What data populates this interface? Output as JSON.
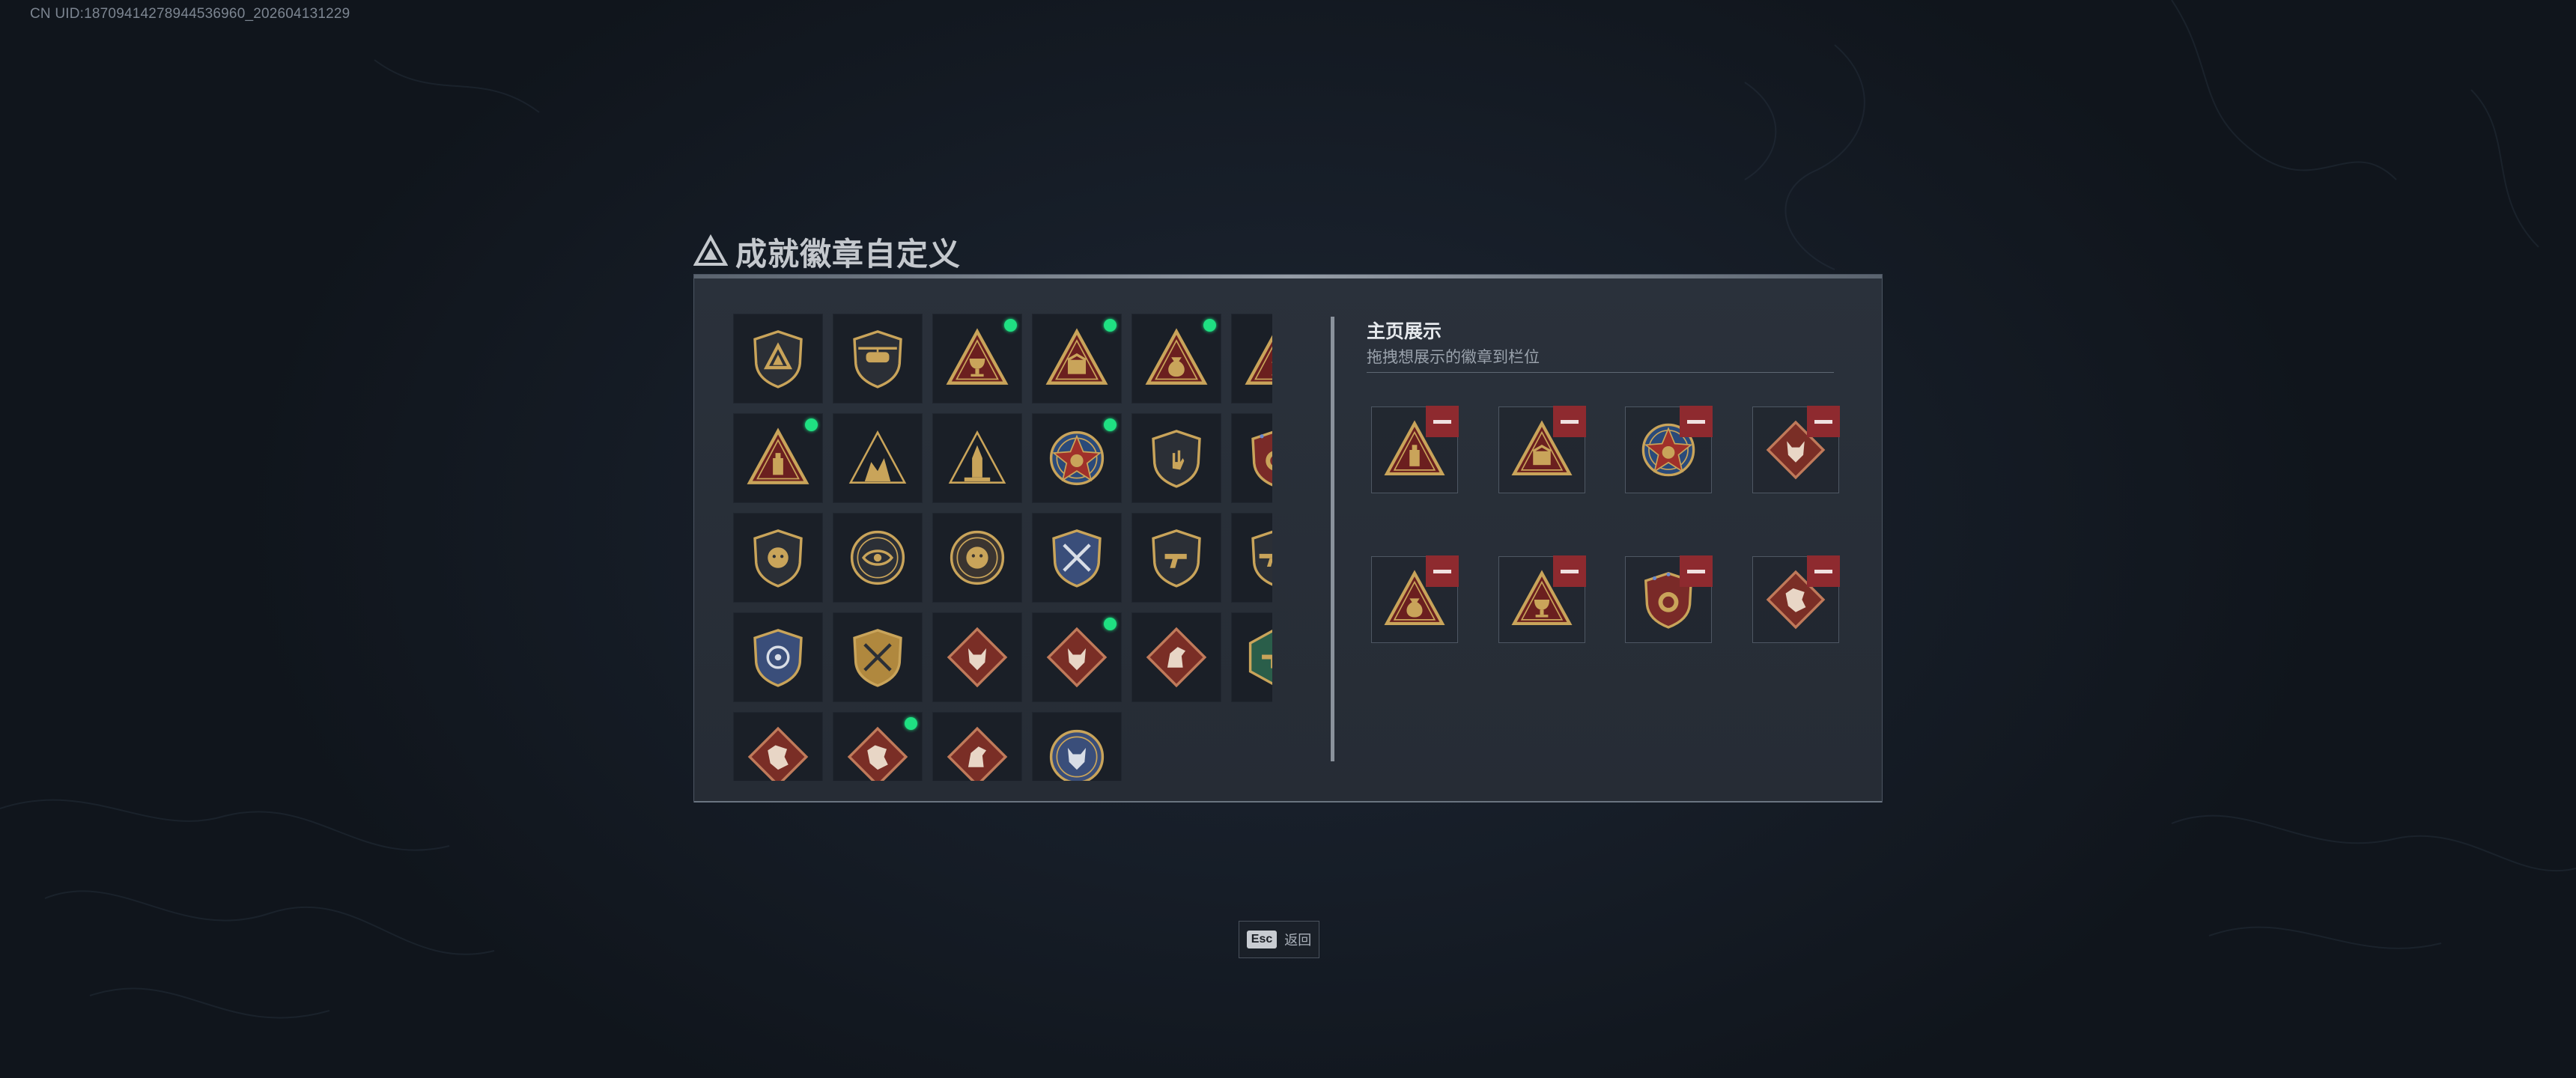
{
  "uid_text": "CN UID:18709414278944536960_202604131229",
  "title": "成就徽章自定义",
  "showcase": {
    "title": "主页展示",
    "subtitle": "拖拽想展示的徽章到栏位"
  },
  "esc": {
    "key": "Esc",
    "label": "返回"
  },
  "colors": {
    "gold": "#c9a45a",
    "dark_red": "#6b1f1f",
    "remove_red": "#8e2a2f",
    "new_dot": "#1fe082",
    "blue_shield": "#3a4e7a",
    "green_hex": "#2a5e4a"
  },
  "badges": [
    {
      "icon": "shield-triangle-badge-icon",
      "is_new": false
    },
    {
      "icon": "helicopter-shield-badge-icon",
      "is_new": false
    },
    {
      "icon": "triangle-chalice-badge-icon",
      "is_new": true
    },
    {
      "icon": "triangle-crate-badge-icon",
      "is_new": true
    },
    {
      "icon": "triangle-moneybag-badge-icon",
      "is_new": true
    },
    {
      "icon": "triangle-number-one-badge-icon",
      "is_new": false
    },
    {
      "icon": "triangle-bottle-badge-icon",
      "is_new": true
    },
    {
      "icon": "triangle-soldiers-badge-icon",
      "is_new": false
    },
    {
      "icon": "triangle-rocket-badge-icon",
      "is_new": false
    },
    {
      "icon": "star-medal-badge-icon",
      "is_new": true
    },
    {
      "icon": "shield-hand-badge-icon",
      "is_new": false
    },
    {
      "icon": "star-shield-emblem-badge-icon",
      "is_new": true
    },
    {
      "icon": "shield-lion-badge-icon",
      "is_new": false
    },
    {
      "icon": "round-eye-badge-icon",
      "is_new": false
    },
    {
      "icon": "round-lion-badge-icon",
      "is_new": false
    },
    {
      "icon": "blue-shield-crossed-rifles-badge-icon",
      "is_new": false
    },
    {
      "icon": "shield-pistol-badge-icon",
      "is_new": false
    },
    {
      "icon": "shield-rifle-badge-icon",
      "is_new": false
    },
    {
      "icon": "blue-shield-target-badge-icon",
      "is_new": false
    },
    {
      "icon": "gold-shield-rifles-badge-icon",
      "is_new": false
    },
    {
      "icon": "diamond-wolf-badge-icon",
      "is_new": false
    },
    {
      "icon": "diamond-wolf-badge-icon",
      "is_new": true
    },
    {
      "icon": "diamond-horse-badge-icon",
      "is_new": false
    },
    {
      "icon": "green-hex-rifle-badge-icon",
      "is_new": false
    },
    {
      "icon": "diamond-dragon-badge-icon",
      "is_new": false
    },
    {
      "icon": "diamond-dragon-badge-icon",
      "is_new": true
    },
    {
      "icon": "diamond-horse-badge-icon",
      "is_new": false
    },
    {
      "icon": "round-blue-wolf-badge-icon",
      "is_new": false
    }
  ],
  "showcase_slots": [
    {
      "icon": "triangle-bottle-badge-icon"
    },
    {
      "icon": "triangle-crate-badge-icon"
    },
    {
      "icon": "star-medal-badge-icon"
    },
    {
      "icon": "diamond-wolf-badge-icon"
    },
    {
      "icon": "triangle-moneybag-badge-icon"
    },
    {
      "icon": "triangle-chalice-badge-icon"
    },
    {
      "icon": "star-shield-emblem-badge-icon"
    },
    {
      "icon": "diamond-dragon-badge-icon"
    }
  ]
}
